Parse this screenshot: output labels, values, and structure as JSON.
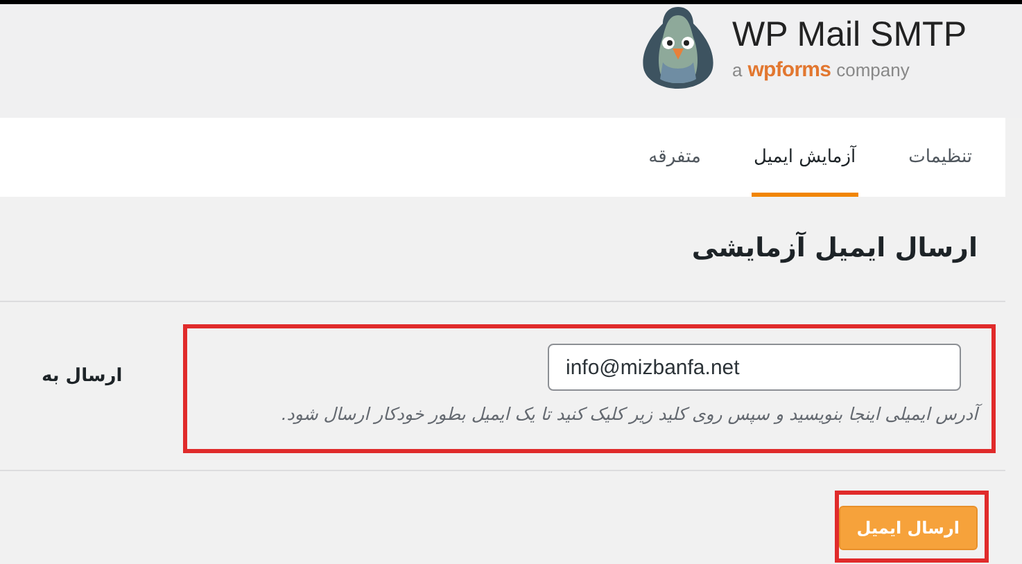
{
  "header": {
    "product": "WP Mail SMTP",
    "tagline_prefix": "a",
    "tagline_brand": "wpforms",
    "tagline_suffix": "company"
  },
  "tabs": [
    {
      "label": "تنظیمات",
      "selected": false
    },
    {
      "label": "آزمایش ایمیل",
      "selected": true
    },
    {
      "label": "متفرقه",
      "selected": false
    }
  ],
  "section_title": "ارسال ایمیل آزمایشی",
  "field": {
    "label": "ارسال به",
    "value": "info@mizbanfa.net",
    "description": "آدرس ایمیلی اینجا بنویسید و سپس روی کلید زیر کلیک کنید تا یک ایمیل بطور خودکار ارسال شود."
  },
  "submit_button": "ارسال ایمیل"
}
